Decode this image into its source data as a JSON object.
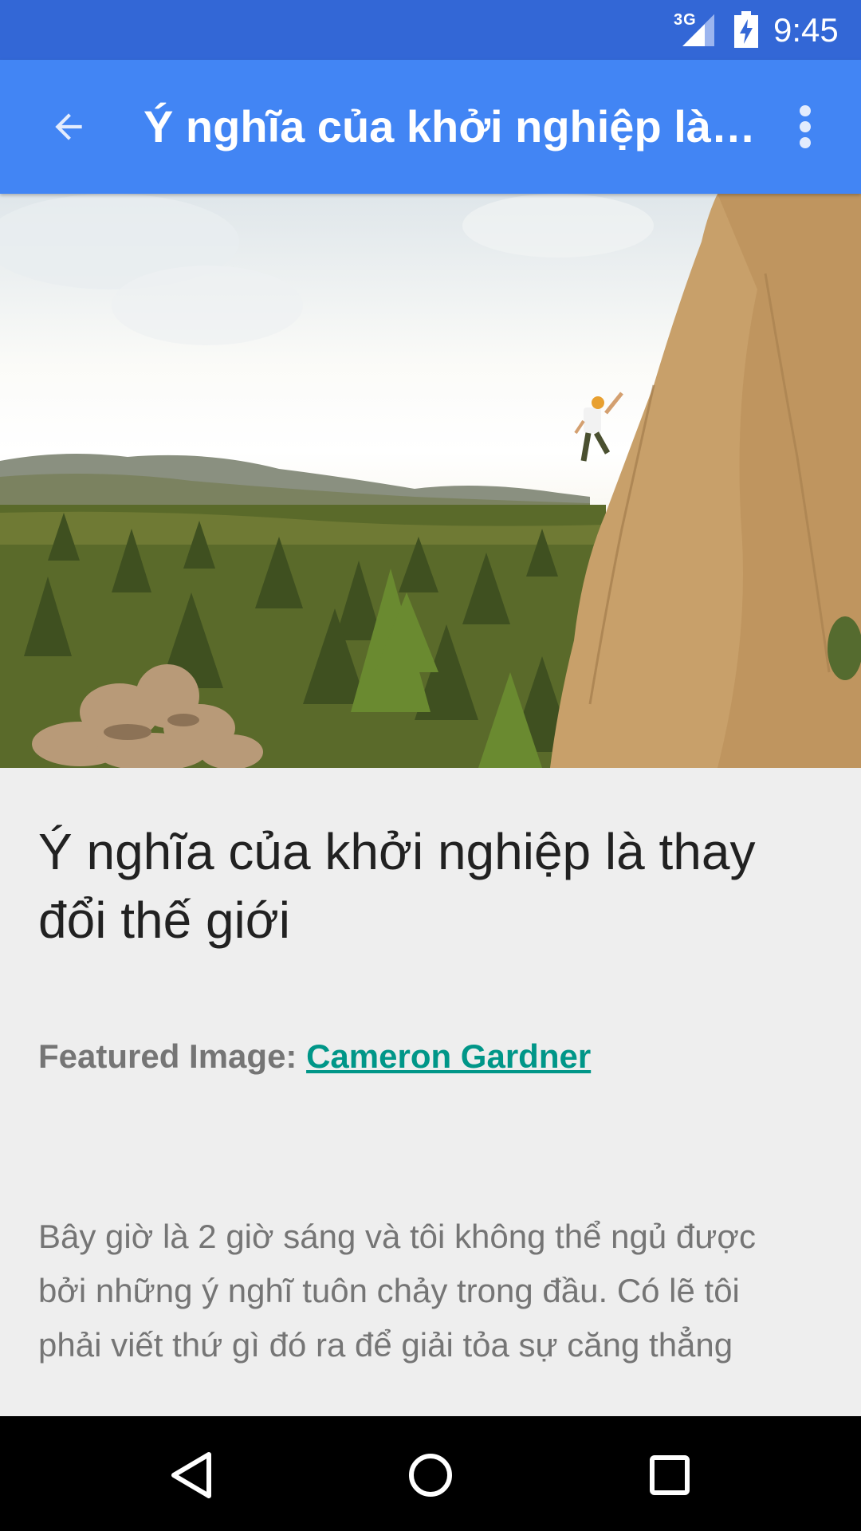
{
  "status_bar": {
    "network": "3G",
    "time": "9:45"
  },
  "app_bar": {
    "title": "Ý nghĩa của khởi nghiệp là thay đổi thế giới",
    "back_icon": "arrow-back-icon",
    "overflow_icon": "more-vert-icon"
  },
  "hero_image": {
    "description": "climber-on-rock-cliff-over-forest"
  },
  "article": {
    "title": "Ý nghĩa của khởi nghiệp là thay đổi thế giới",
    "credit_label": "Featured Image:",
    "credit_link": "Cameron Gardner",
    "body": "Bây giờ là 2 giờ sáng và tôi không thể ngủ được bởi những ý nghĩ tuôn chảy trong đầu. Có lẽ tôi phải viết thứ gì đó ra để giải tỏa sự căng thẳng"
  },
  "nav_bar": {
    "back_icon": "nav-back-icon",
    "home_icon": "nav-home-icon",
    "recents_icon": "nav-recents-icon"
  },
  "colors": {
    "status_bar": "#3367d6",
    "app_bar": "#4285f4",
    "link": "#009688",
    "background": "#eeeeee"
  }
}
